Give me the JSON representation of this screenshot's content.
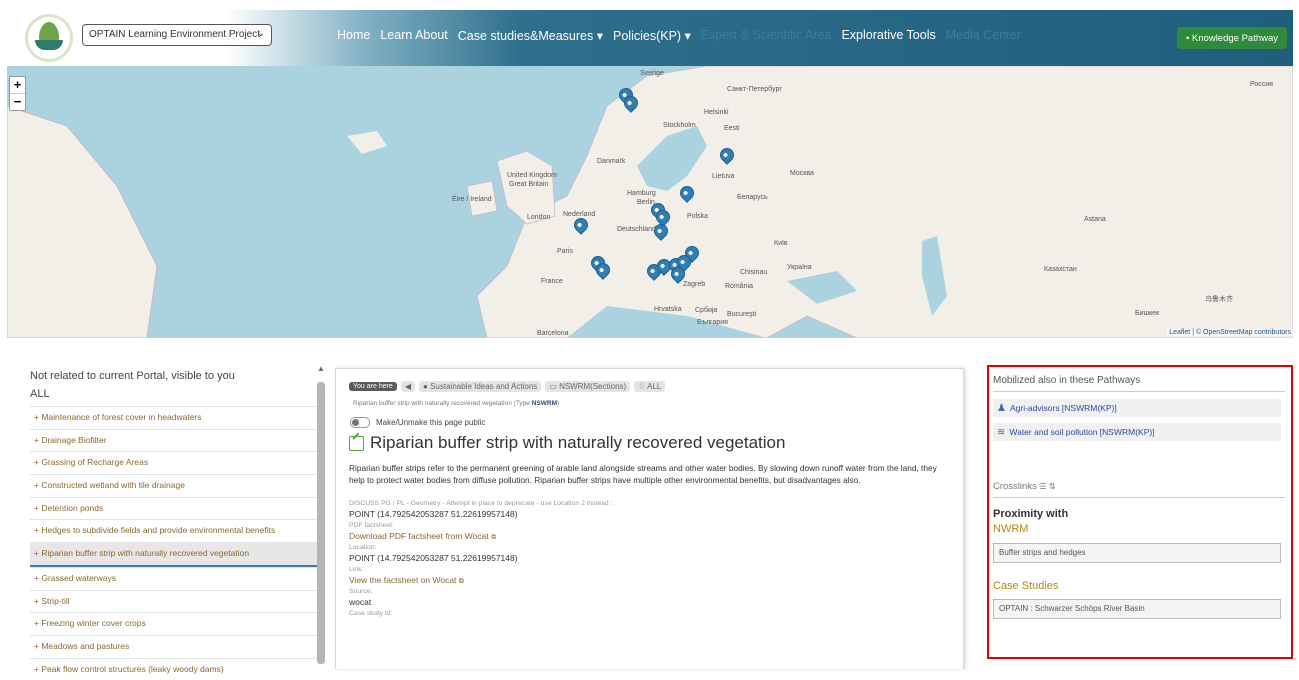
{
  "header": {
    "project_select": "OPTAIN Learning Environment Project",
    "nav": [
      {
        "label": "Home",
        "dim": false
      },
      {
        "label": "Learn About",
        "dim": false
      },
      {
        "label": "Case studies&Measures ▾",
        "dim": false
      },
      {
        "label": "Policies(KP) ▾",
        "dim": false
      },
      {
        "label": "Expert & Scientific Area",
        "dim": true
      },
      {
        "label": "Explorative Tools",
        "dim": false
      },
      {
        "label": "Media Center",
        "dim": true
      }
    ],
    "knowledge_pathway": "• Knowledge Pathway"
  },
  "map": {
    "zoom_in": "+",
    "zoom_out": "−",
    "attribution": "Leaflet | © OpenStreetMap contributors",
    "labels": [
      "Sverige",
      "Санкт-Петербург",
      "Helsinki",
      "Stockholm",
      "Eesti",
      "Danmark",
      "Lietuva",
      "Москва",
      "United Kingdom",
      "Great Britain",
      "Hamburg",
      "Беларусь",
      "Éire / Ireland",
      "London",
      "Nederland",
      "Berlin",
      "Polska",
      "Deutschland",
      "Paris",
      "Київ",
      "Україна",
      "Astana",
      "Казахстан",
      "France",
      "Chisinau",
      "Zagreb",
      "România",
      "Hrvatska",
      "Србија",
      "Bucureşti",
      "България",
      "Barcelona",
      "Россия",
      "Бишкек",
      "乌鲁木齐"
    ]
  },
  "sidebar": {
    "title": "Not related to current Portal, visible to you",
    "all_label": "ALL",
    "items": [
      "+ Maintenance of forest cover in headwaters",
      "+ Drainage Biofilter",
      "+ Grassing of Recharge Areas",
      "+ Constructed wetland with tile drainage",
      "+ Detention ponds",
      "+ Hedges to subdivide fields and provide environmental benefits",
      "+ Riparian buffer strip with naturally recovered vegetation",
      "+ Grassed waterways",
      "+ Strip-till",
      "+ Freezing winter cover crops",
      "+ Meadows and pastures",
      "+ Peak flow control structures (leaky woody dams)"
    ],
    "selected_index": 6
  },
  "main": {
    "you_are_here": "You are here",
    "crumb1": "Sustainable Ideas and Actions",
    "crumb2": "NSWRM(Sections)",
    "crumb3": "ALL",
    "subline_prefix": "Riparian buffer strip with naturally recovered vegetation (Type",
    "subline_type": "NSWRM",
    "subline_suffix": ")",
    "public_toggle": "Make/Unmake this page public",
    "title": "Riparian buffer strip with naturally recovered vegetation",
    "description": "Riparian buffer strips refer to the permanent greening of arable land alongside streams and other water bodies. By slowing down runoff water from the land, they help to protect water bodies from diffuse pollution. Riparian buffer strips have multiple other environmental benefits, but disadvantages also.",
    "fields": [
      {
        "label": "DISCUSS PG / PL - Geometry - Attempt in place to deprecate - use Location 2 instead :",
        "value": "POINT (14.792542053287 51.22619957148)",
        "link": false
      },
      {
        "label": "PDF factsheet:",
        "value": "Download PDF factsheet from Wocat",
        "link": true
      },
      {
        "label": "Location:",
        "value": "POINT (14.792542053287 51.22619957148)",
        "link": false
      },
      {
        "label": "Link:",
        "value": "View the factsheet on Wocat",
        "link": true
      },
      {
        "label": "Source:",
        "value": "wocat",
        "link": false
      },
      {
        "label": "Case study id:",
        "value": "",
        "link": false
      }
    ]
  },
  "right": {
    "mobilized_title": "Mobilized also in these Pathways",
    "pathway1": "Agri-advisors [NSWRM(KP)]",
    "pathway2": "Water and soil pollution [NSWRM(KP)]",
    "crosslinks": "Crosslinks",
    "proximity": "Proximity with",
    "nwrm": "NWRM",
    "nwrm_tag": "Buffer strips and hedges",
    "case_studies": "Case Studies",
    "case_tag": "OPTAIN : Schwarzer Schöps River Basin"
  },
  "colors": {
    "header_dark": "#1f5e7c",
    "kp_button": "#2e8b3c",
    "highlight_border": "#e10000",
    "link_brown": "#8a6a30"
  }
}
